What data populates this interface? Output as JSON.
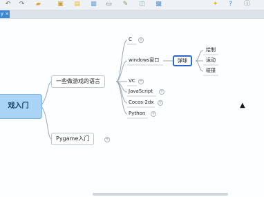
{
  "toolbar": {
    "icons": [
      "undo-icon",
      "redo-icon",
      "folder-icon",
      "open-icon",
      "note-icon",
      "image-icon",
      "label-icon",
      "marker-icon",
      "summary-icon",
      "insert-image-icon",
      "idea-icon",
      "help-icon",
      "info-icon"
    ]
  },
  "tab": {
    "label": "y ×"
  },
  "mindmap": {
    "root": "戏入门",
    "branch1": "一些做游戏的语言",
    "branch2": "Pygame入门",
    "langs": [
      "C",
      "windows窗口",
      "VC",
      "JavaScript",
      "Cocos-2dx",
      "Python"
    ],
    "selected": "弹球",
    "actions": [
      "绘制",
      "运动",
      "碰撞"
    ]
  }
}
